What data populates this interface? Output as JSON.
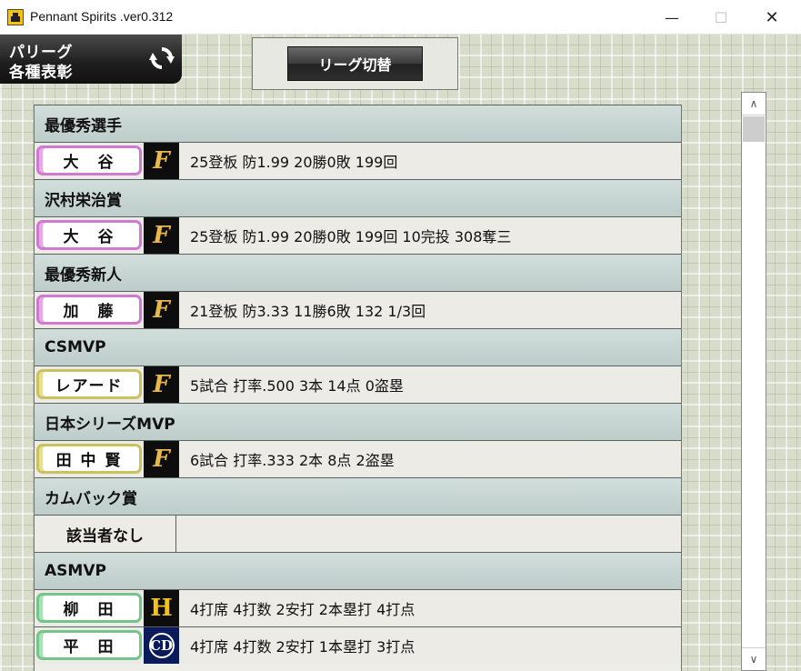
{
  "window": {
    "title": "Pennant Spirits .ver0.312",
    "minimize_glyph": "—",
    "maximize_glyph": "☐",
    "close_glyph": "✕"
  },
  "league_panel": {
    "line1": "パリーグ",
    "line2": "各種表彰",
    "icon": "refresh-icon"
  },
  "switch_button": {
    "label": "リーグ切替"
  },
  "awards": [
    {
      "category": "最優秀選手",
      "name": "大　谷",
      "name_color": "pink",
      "team_logo": "F",
      "team": "fighters",
      "stats": "25登板 防1.99 20勝0敗 199回"
    },
    {
      "category": "沢村栄治賞",
      "name": "大　谷",
      "name_color": "pink",
      "team_logo": "F",
      "team": "fighters",
      "stats": "25登板 防1.99 20勝0敗 199回 10完投 308奪三"
    },
    {
      "category": "最優秀新人",
      "name": "加　藤",
      "name_color": "pink",
      "team_logo": "F",
      "team": "fighters",
      "stats": "21登板 防3.33 11勝6敗 132 1/3回"
    },
    {
      "category": "CSMVP",
      "name": "レアード",
      "name_color": "yellow",
      "team_logo": "F",
      "team": "fighters",
      "stats": "5試合 打率.500 3本 14点 0盗塁"
    },
    {
      "category": "日本シリーズMVP",
      "name": "田 中 賢",
      "name_color": "yellow",
      "team_logo": "F",
      "team": "fighters",
      "stats": "6試合 打率.333 2本 8点 2盗塁"
    },
    {
      "category": "カムバック賞",
      "none_text": "該当者なし"
    },
    {
      "category": "ASMVP",
      "name": "柳　田",
      "name_color": "green",
      "team_logo": "H",
      "team": "hawks",
      "stats": "4打席 4打数 2安打 2本塁打 4打点"
    },
    {
      "category": "",
      "name": "平　田",
      "name_color": "green",
      "team_logo": "CD",
      "team": "dragons",
      "stats": "4打席 4打数 2安打 1本塁打 3打点"
    }
  ],
  "scrollbar": {
    "up_glyph": "∧",
    "down_glyph": "∨"
  },
  "colors": {
    "fighters_logo": "#e8b84a",
    "hawks_logo": "#f4c21a",
    "dragons_logo": "#ffffff"
  }
}
